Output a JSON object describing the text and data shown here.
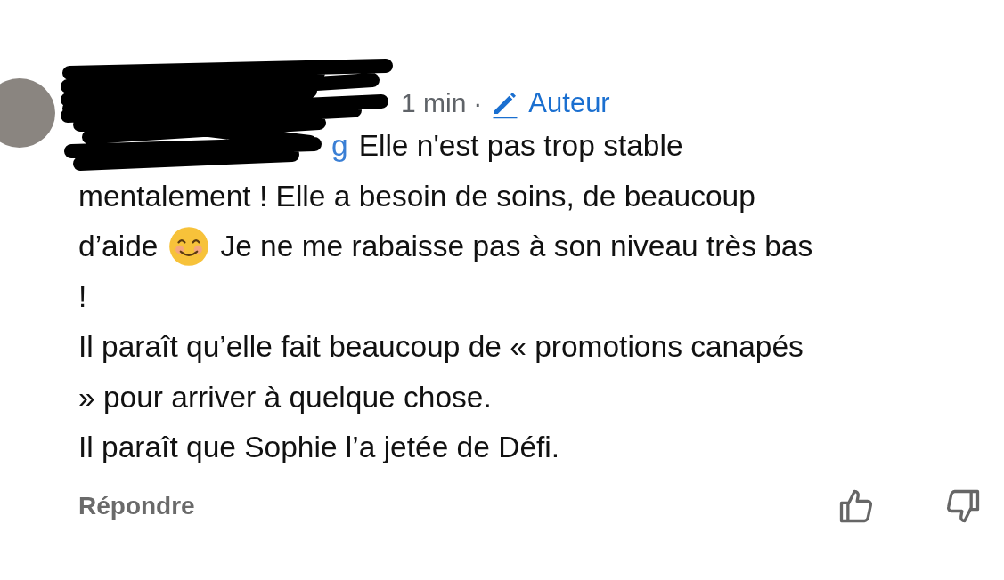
{
  "comment": {
    "time": "1 min",
    "separator": "·",
    "author_badge": "Auteur",
    "mention": "g",
    "lines": [
      [
        {
          "kind": "text",
          "text": "Elle n'est pas trop stable"
        }
      ],
      [
        {
          "kind": "text",
          "text": "mentalement ! Elle a besoin de soins, de beaucoup"
        }
      ],
      [
        {
          "kind": "text",
          "text": "d’aide"
        },
        {
          "kind": "emoji"
        },
        {
          "kind": "text",
          "text": "Je ne me rabaisse pas à son niveau très bas"
        }
      ],
      [
        {
          "kind": "text",
          "text": "!"
        }
      ],
      [
        {
          "kind": "text",
          "text": "Il paraît qu’elle fait beaucoup de « promotions canapés"
        }
      ],
      [
        {
          "kind": "text",
          "text": "» pour arriver à quelque chose."
        }
      ],
      [
        {
          "kind": "text",
          "text": "Il paraît que Sophie l’a jetée de Défi."
        }
      ]
    ],
    "reply": "Répondre"
  }
}
